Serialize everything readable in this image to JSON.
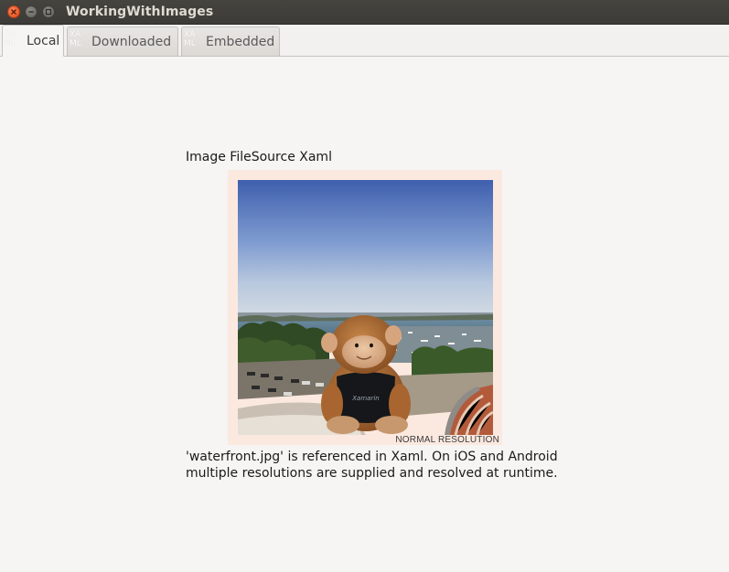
{
  "window": {
    "title": "WorkingWithImages"
  },
  "tabs": [
    {
      "icon_line1": "XA",
      "icon_line2": "ML",
      "label": "Local",
      "active": true
    },
    {
      "icon_line1": "XA",
      "icon_line2": "ML",
      "label": "Downloaded",
      "active": false
    },
    {
      "icon_line1": "XA",
      "icon_line2": "ML",
      "label": "Embedded",
      "active": false
    }
  ],
  "content": {
    "heading": "Image FileSource Xaml",
    "image": {
      "overlay_label": "NORMAL RESOLUTION",
      "shirt_text": "Xamarin"
    },
    "caption": "'waterfront.jpg' is referenced in Xaml. On iOS and Android multiple resolutions are supplied and resolved at runtime."
  },
  "colors": {
    "titlebar": "#3c3b37",
    "close_button": "#e95420",
    "window_bg": "#f6f5f4",
    "photo_frame": "#fbe9e0"
  },
  "icons": {
    "close": "close-icon",
    "minimize": "minimize-icon",
    "maximize": "maximize-icon",
    "tab": "xaml-icon"
  }
}
